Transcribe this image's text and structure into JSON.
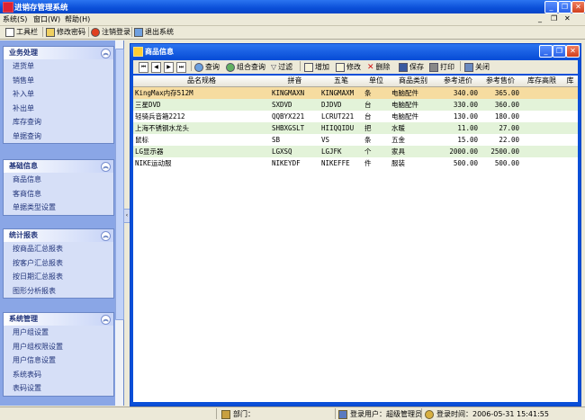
{
  "app": {
    "title": "进销存管理系统"
  },
  "menu": [
    "系统(S)",
    "窗口(W)",
    "帮助(H)"
  ],
  "toolbar": {
    "tools": "工具栏",
    "change_password": "修改密码",
    "logout": "注销登录",
    "exit": "退出系统"
  },
  "sidebar": {
    "groups": [
      {
        "title": "业务处理",
        "items": [
          "进货单",
          "销售单",
          "补入单",
          "补出单",
          "库存查询",
          "单据查询"
        ]
      },
      {
        "title": "基础信息",
        "items": [
          "商品信息",
          "客商信息",
          "单据类型设置"
        ]
      },
      {
        "title": "统计报表",
        "items": [
          "按商品汇总报表",
          "按客户汇总报表",
          "按日期汇总报表",
          "图形分析报表"
        ]
      },
      {
        "title": "系统管理",
        "items": [
          "用户组设置",
          "用户组权限设置",
          "用户信息设置",
          "系统表码",
          "表码设置"
        ]
      }
    ]
  },
  "window": {
    "title": "商品信息",
    "toolbar": {
      "query": "查询",
      "combo_query": "组合查询",
      "filter": "过滤",
      "add": "增加",
      "edit": "修改",
      "delete": "删除",
      "save": "保存",
      "print": "打印",
      "close": "关闭"
    }
  },
  "grid": {
    "columns": [
      "品名规格",
      "拼音",
      "五笔",
      "单位",
      "商品类别",
      "参考进价",
      "参考售价",
      "库存高限",
      "库"
    ],
    "rows": [
      [
        "KingMax内存512M",
        "KINGMAXN",
        "KINGMAXM",
        "条",
        "电脑配件",
        "340.00",
        "365.00",
        ""
      ],
      [
        "三星DVD",
        "SXDVD",
        "DJDVD",
        "台",
        "电脑配件",
        "330.00",
        "360.00",
        ""
      ],
      [
        "轻骑兵音箱2212",
        "QQBYX221",
        "LCRUT221",
        "台",
        "电脑配件",
        "130.00",
        "180.00",
        ""
      ],
      [
        "上海不锈钢水龙头",
        "SHBXGSLT",
        "HIIQQIDU",
        "把",
        "水暖",
        "11.00",
        "27.00",
        ""
      ],
      [
        "鼠标",
        "SB",
        "VS",
        "条",
        "五金",
        "15.00",
        "22.00",
        ""
      ],
      [
        "LG显示器",
        "LGXSQ",
        "LGJFK",
        "个",
        "家具",
        "2000.00",
        "2500.00",
        ""
      ],
      [
        "NIKE运动服",
        "NIKEYDF",
        "NIKEFFE",
        "件",
        "服装",
        "500.00",
        "500.00",
        ""
      ]
    ],
    "row_colors": [
      "#f6dca0",
      "#e3f3d9",
      "#ffffff",
      "#e3f3d9",
      "#ffffff",
      "#e3f3d9",
      "#ffffff"
    ]
  },
  "status": {
    "department": "部门：",
    "user": "登录用户：超级管理员",
    "time": "登录时间：2006-05-31 15:41:55"
  }
}
